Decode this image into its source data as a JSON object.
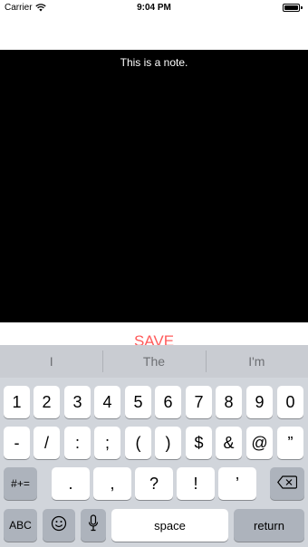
{
  "status_bar": {
    "carrier": "Carrier",
    "time": "9:04 PM"
  },
  "note": {
    "text": "This is a note."
  },
  "save_label": "SAVE",
  "keyboard": {
    "suggestions": [
      "I",
      "The",
      "I'm"
    ],
    "row1": [
      "1",
      "2",
      "3",
      "4",
      "5",
      "6",
      "7",
      "8",
      "9",
      "0"
    ],
    "row2": [
      "-",
      "/",
      ":",
      ";",
      "(",
      ")",
      "$",
      "&",
      "@",
      "”"
    ],
    "row3_left": "#+=",
    "row3": [
      ".",
      ",",
      "?",
      "!",
      "’"
    ],
    "abc_label": "ABC",
    "space_label": "space",
    "return_label": "return"
  },
  "colors": {
    "save": "#ff5b5b",
    "note_background": "#000000",
    "keyboard_background": "#d1d5db"
  },
  "icons": [
    "wifi-icon",
    "battery-icon",
    "backspace-icon",
    "emoji-icon",
    "microphone-icon"
  ]
}
